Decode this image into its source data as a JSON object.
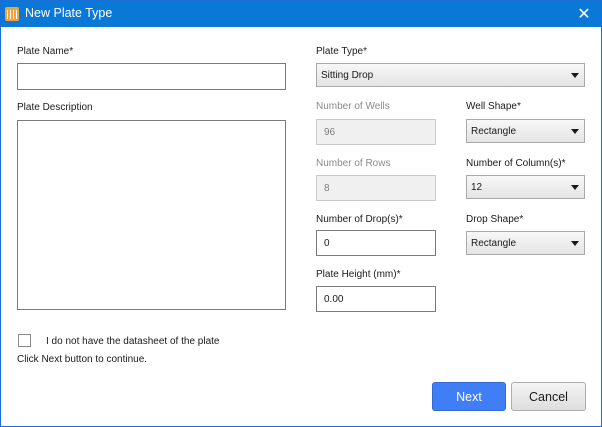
{
  "window": {
    "title": "New Plate Type",
    "close_icon": "✕"
  },
  "form": {
    "plate_name": {
      "label": "Plate Name*",
      "value": ""
    },
    "plate_description": {
      "label": "Plate Description",
      "value": ""
    },
    "plate_type": {
      "label": "Plate Type*",
      "value": "Sitting Drop"
    },
    "number_of_wells": {
      "label": "Number of Wells",
      "value": "96",
      "disabled": true
    },
    "well_shape": {
      "label": "Well Shape*",
      "value": "Rectangle"
    },
    "number_of_rows": {
      "label": "Number of Rows",
      "value": "8",
      "disabled": true
    },
    "number_of_columns": {
      "label": "Number of Column(s)*",
      "value": "12"
    },
    "number_of_drops": {
      "label": "Number of Drop(s)*",
      "value": "0"
    },
    "drop_shape": {
      "label": "Drop Shape*",
      "value": "Rectangle"
    },
    "plate_height": {
      "label": "Plate Height (mm)*",
      "value": "0.00"
    },
    "no_datasheet": {
      "label": "I do not have the datasheet of the plate",
      "checked": false
    },
    "hint": "Click Next button to continue."
  },
  "buttons": {
    "next": "Next",
    "cancel": "Cancel"
  },
  "colors": {
    "titlebar": "#0a78d7",
    "primary_button": "#3f7ef6",
    "app_icon": "#f2a23a"
  }
}
